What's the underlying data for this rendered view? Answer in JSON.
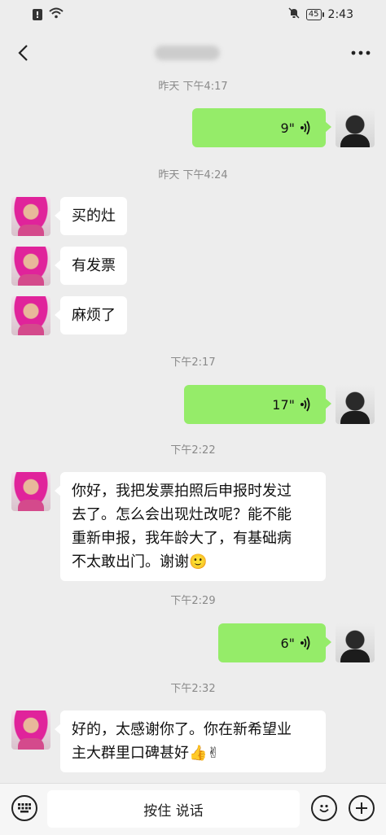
{
  "status_bar": {
    "time": "2:43",
    "battery": "45"
  },
  "header": {
    "title": ""
  },
  "messages": [
    {
      "type": "timestamp",
      "text": "昨天 下午4:17"
    },
    {
      "type": "voice",
      "side": "out",
      "duration": "9\""
    },
    {
      "type": "timestamp",
      "text": "昨天 下午4:24"
    },
    {
      "type": "text",
      "side": "in",
      "text": "买的灶"
    },
    {
      "type": "text",
      "side": "in",
      "text": "有发票"
    },
    {
      "type": "text",
      "side": "in",
      "text": "麻烦了"
    },
    {
      "type": "timestamp",
      "text": "下午2:17"
    },
    {
      "type": "voice",
      "side": "out",
      "duration": "17\""
    },
    {
      "type": "timestamp",
      "text": "下午2:22"
    },
    {
      "type": "text",
      "side": "in",
      "lines": [
        "你好，我把发票拍照后申报时发过",
        "去了。怎么会出现灶改呢？能不能",
        "重新申报，我年龄大了，有基础病",
        "不太敢出门。谢谢🙂"
      ]
    },
    {
      "type": "timestamp",
      "text": "下午2:29"
    },
    {
      "type": "voice",
      "side": "out",
      "duration": "6\""
    },
    {
      "type": "timestamp",
      "text": "下午2:32"
    },
    {
      "type": "text",
      "side": "in",
      "lines": [
        "好的，太感谢你了。你在新希望业",
        "主大群里口碑甚好👍✌"
      ]
    }
  ],
  "input_bar": {
    "hold_to_talk": "按住 说话"
  },
  "icons": {
    "back": "back-arrow-icon",
    "more": "more-icon",
    "keyboard": "keyboard-icon",
    "emoji": "emoji-icon",
    "plus": "plus-icon",
    "voice_wave": "voice-wave-icon"
  },
  "colors": {
    "outgoing_bubble": "#95ec69",
    "incoming_bubble": "#ffffff",
    "background": "#ededed"
  }
}
